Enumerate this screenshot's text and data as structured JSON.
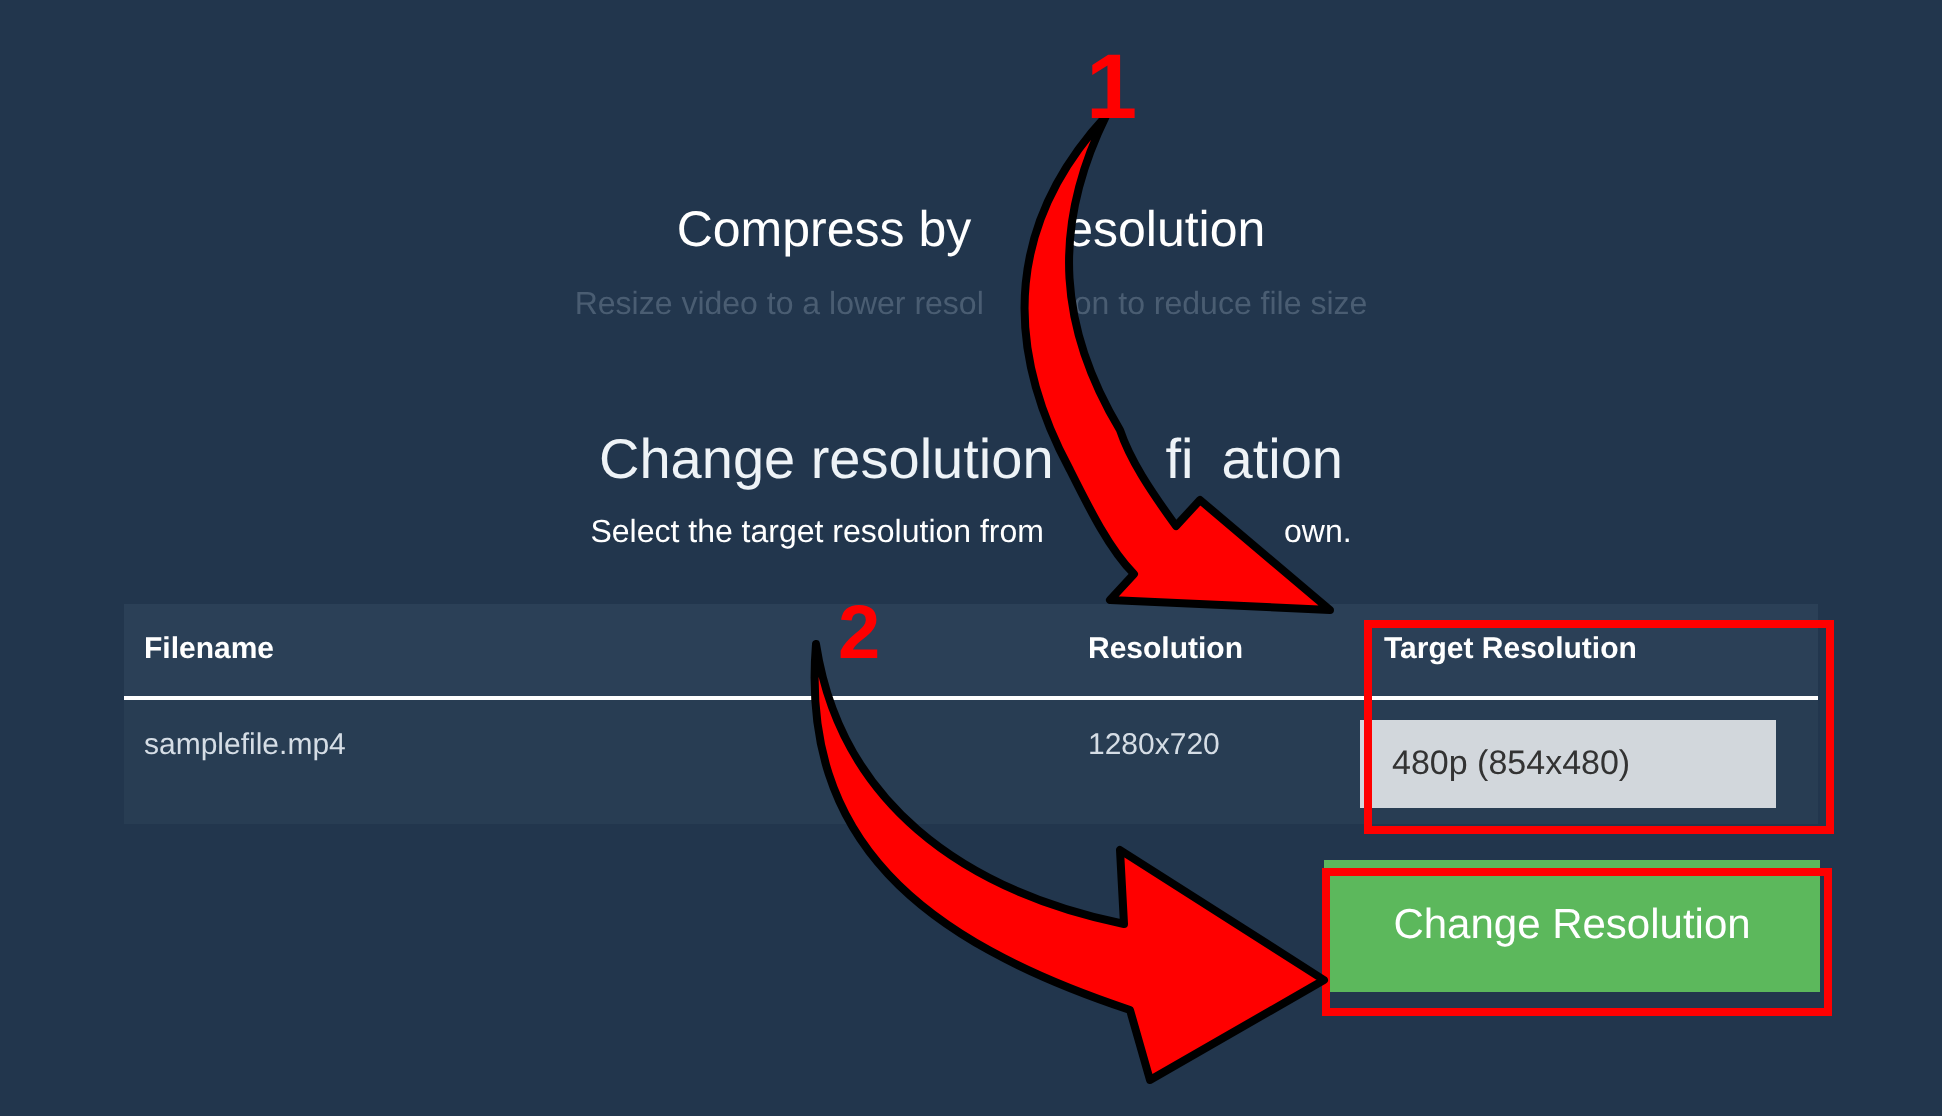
{
  "header": {
    "title_parts": [
      "Compress by",
      "esolution"
    ],
    "subtitle_parts": [
      "Resize video to a lower resol",
      "on to reduce file size"
    ]
  },
  "confirmation": {
    "heading_parts": [
      "Change resolution",
      "fi",
      "ation"
    ],
    "instruction_parts": [
      "Select the target resolution from",
      "own."
    ]
  },
  "table": {
    "columns": [
      "Filename",
      "Resolution",
      "Target Resolution"
    ],
    "rows": [
      {
        "filename": "samplefile.mp4",
        "resolution": "1280x720",
        "target": "480p (854x480)"
      }
    ]
  },
  "button": {
    "label": "Change Resolution"
  },
  "annotations": [
    {
      "label": "1"
    },
    {
      "label": "2"
    }
  ]
}
